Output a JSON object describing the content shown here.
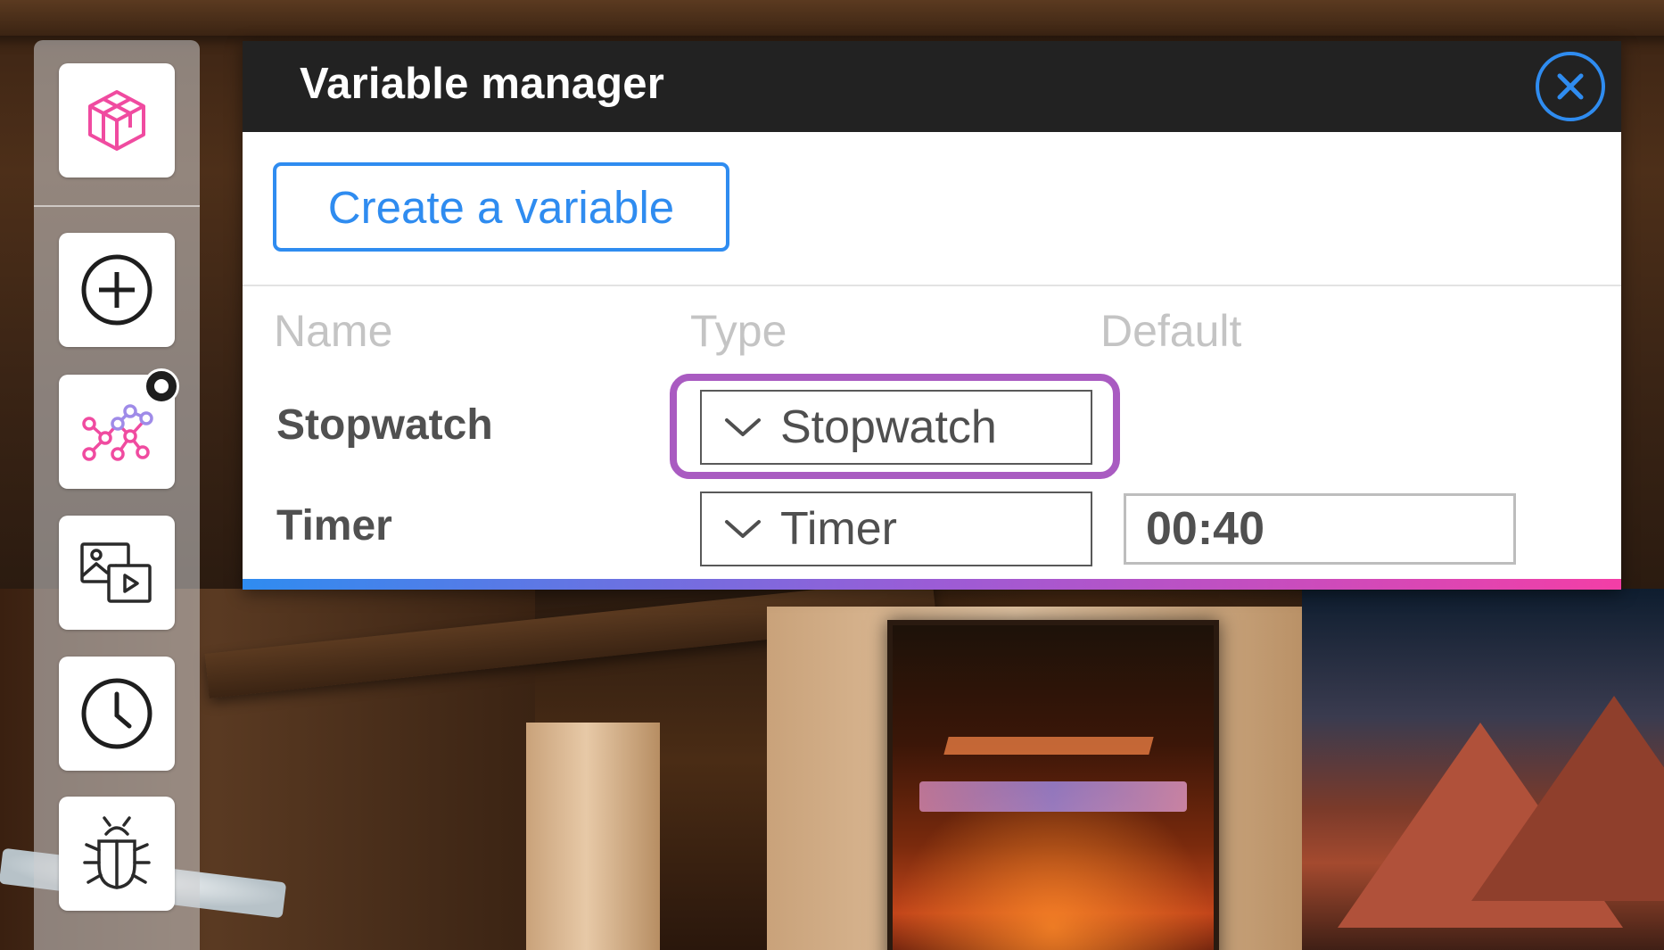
{
  "sidebar": {
    "tools": [
      {
        "icon": "cube-icon",
        "color": "#f04ba0"
      },
      {
        "icon": "add-circle-icon"
      },
      {
        "icon": "node-graph-icon",
        "color": "#f04ba0",
        "has_badge": true
      },
      {
        "icon": "media-icon"
      },
      {
        "icon": "clock-icon"
      },
      {
        "icon": "bug-icon"
      }
    ]
  },
  "dialog": {
    "title": "Variable manager",
    "close_icon": "close-icon",
    "create_button_label": "Create a variable",
    "columns": {
      "name": "Name",
      "type": "Type",
      "default": "Default"
    },
    "rows": [
      {
        "name": "Stopwatch",
        "type": "Stopwatch",
        "default": ""
      },
      {
        "name": "Timer",
        "type": "Timer",
        "default": "00:40"
      }
    ]
  },
  "colors": {
    "accent": "#2f8cf0",
    "highlight": "#a95bc1",
    "header_bg": "#222222",
    "gradient_end": "#f33ea6"
  }
}
